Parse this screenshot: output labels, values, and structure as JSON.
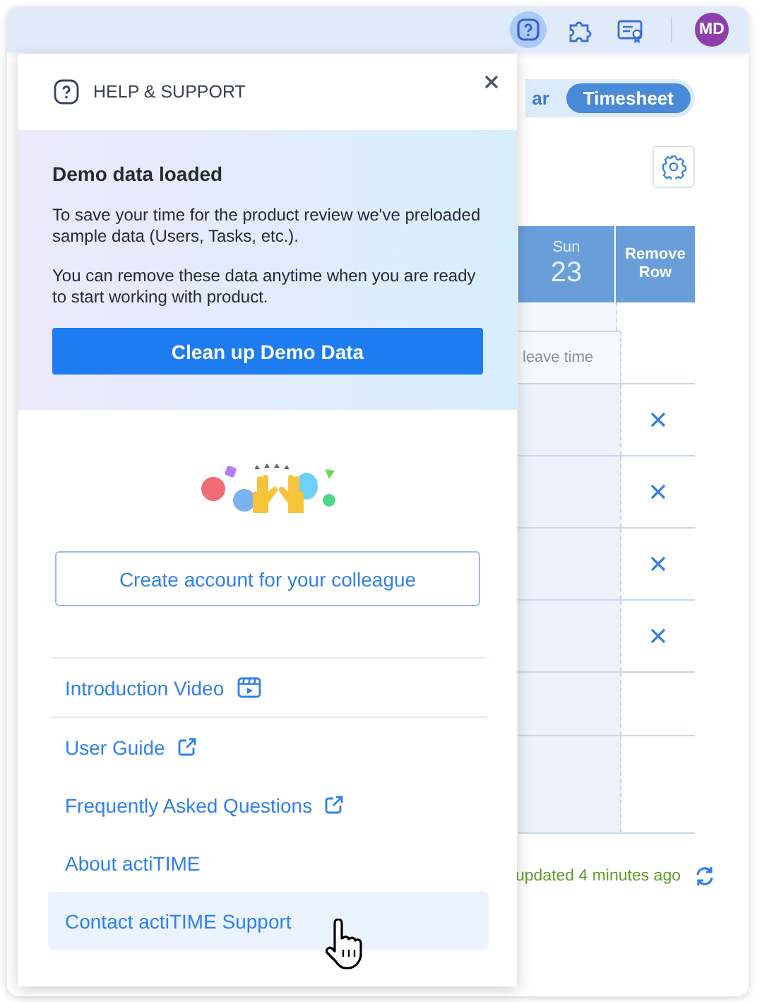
{
  "topbar": {
    "icons": [
      {
        "kind": "help",
        "selected": true
      },
      {
        "kind": "puzzle",
        "selected": false
      },
      {
        "kind": "certificate",
        "selected": false
      }
    ],
    "avatar": "MD"
  },
  "view_tabs": [
    {
      "label": "ar",
      "selected": false
    },
    {
      "label": "Timesheet",
      "selected": true
    }
  ],
  "table": {
    "weekday": "Sun",
    "date": "23",
    "remove_column": "Remove Row",
    "rows": [
      {
        "note": "leave time",
        "removable": false
      },
      {
        "removable": true
      },
      {
        "removable": true
      },
      {
        "removable": true
      },
      {
        "removable": true
      },
      {
        "removable": false
      },
      {
        "removable": false
      }
    ]
  },
  "status": "updated 4 minutes ago",
  "help_panel": {
    "title": "HELP & SUPPORT",
    "demo": {
      "heading": "Demo data loaded",
      "paragraphs": [
        "To save your time for the product review we've preloaded sample data (Users, Tasks, etc.).",
        "You can remove these data anytime when you are ready to start working with product."
      ],
      "button": "Clean up Demo Data"
    },
    "invite_button": "Create account for your colleague",
    "links": [
      {
        "label": "Introduction Video",
        "kind": "video",
        "divider_before": true,
        "selected": false
      },
      {
        "label": "User Guide",
        "kind": "external",
        "divider_before": true,
        "selected": false
      },
      {
        "label": "Frequently Asked Questions",
        "kind": "external",
        "divider_before": false,
        "selected": false
      },
      {
        "label": "About actiTIME",
        "kind": "plain",
        "divider_before": false,
        "selected": false
      },
      {
        "label": "Contact actiTIME Support",
        "kind": "plain",
        "divider_before": false,
        "selected": true
      }
    ]
  }
}
